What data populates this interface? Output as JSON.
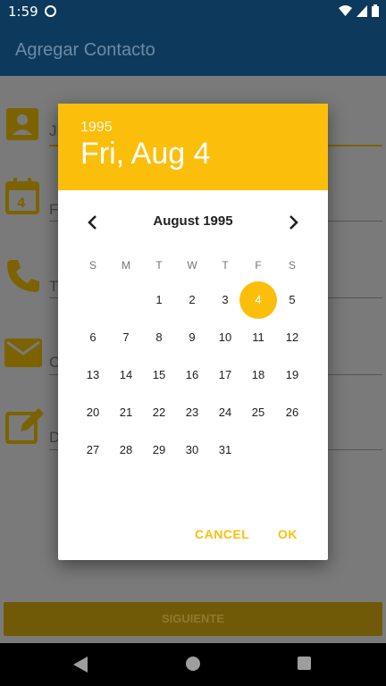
{
  "status_bar": {
    "time": "1:59"
  },
  "app_bar": {
    "title": "Agregar Contacto"
  },
  "form": {
    "next_button": "SIGUIENTE",
    "field_letters": [
      "J",
      "F",
      "T",
      "C",
      "D"
    ]
  },
  "date_picker": {
    "header_year": "1995",
    "header_date": "Fri, Aug 4",
    "month_label": "August 1995",
    "weekdays": [
      "S",
      "M",
      "T",
      "W",
      "T",
      "F",
      "S"
    ],
    "days": [
      "1",
      "2",
      "3",
      "4",
      "5",
      "6",
      "7",
      "8",
      "9",
      "10",
      "11",
      "12",
      "13",
      "14",
      "15",
      "16",
      "17",
      "18",
      "19",
      "20",
      "21",
      "22",
      "23",
      "24",
      "25",
      "26",
      "27",
      "28",
      "29",
      "30",
      "31"
    ],
    "selected_day": "4",
    "cancel_label": "CANCEL",
    "ok_label": "OK"
  },
  "colors": {
    "accent": "#fbbf0b",
    "app_bar": "#0d3a5c"
  },
  "icons": [
    "contact-icon",
    "calendar-icon",
    "phone-icon",
    "email-icon",
    "edit-icon",
    "chevron-left-icon",
    "chevron-right-icon"
  ]
}
